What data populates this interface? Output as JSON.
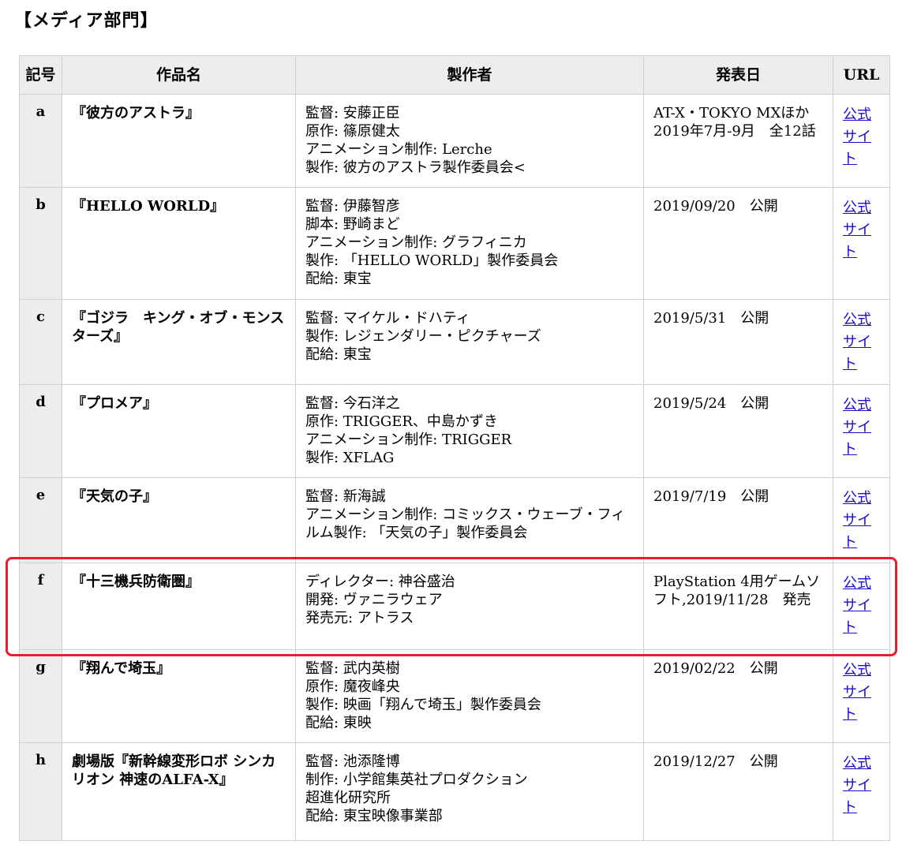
{
  "heading": "【メディア部門】",
  "columns": [
    "記号",
    "作品名",
    "製作者",
    "発表日",
    "URL"
  ],
  "rows": [
    {
      "mark": "a",
      "title": "『彼方のアストラ』",
      "maker": [
        "監督: 安藤正臣",
        "原作: 篠原健太",
        "アニメーション制作: Lerche",
        "製作: 彼方のアストラ製作委員会<"
      ],
      "date": [
        "AT-X・TOKYO MXほか",
        "2019年7月-9月　全12話"
      ],
      "url": [
        "公式",
        "サイ",
        "ト"
      ]
    },
    {
      "mark": "b",
      "title": "『HELLO WORLD』",
      "maker": [
        "監督: 伊藤智彦",
        "脚本: 野崎まど",
        "アニメーション制作: グラフィニカ",
        "製作: 「HELLO WORLD」製作委員会",
        "配給: 東宝"
      ],
      "date": [
        "2019/09/20　公開"
      ],
      "url": [
        "公式",
        "サイ",
        "ト"
      ]
    },
    {
      "mark": "c",
      "title": "『ゴジラ　キング・オブ・モンスターズ』",
      "maker": [
        "監督: マイケル・ドハティ",
        "製作: レジェンダリー・ピクチャーズ",
        "配給: 東宝"
      ],
      "date": [
        "2019/5/31　公開"
      ],
      "url": [
        "公式",
        "サイ",
        "ト"
      ]
    },
    {
      "mark": "d",
      "title": "『プロメア』",
      "maker": [
        "監督: 今石洋之",
        "原作: TRIGGER、中島かずき",
        "アニメーション制作: TRIGGER",
        "製作: XFLAG"
      ],
      "date": [
        "2019/5/24　公開"
      ],
      "url": [
        "公式",
        "サイ",
        "ト"
      ]
    },
    {
      "mark": "e",
      "title": "『天気の子』",
      "maker": [
        "監督: 新海誠",
        "アニメーション制作: コミックス・ウェーブ・フィルム製作: 「天気の子」製作委員会"
      ],
      "date": [
        "2019/7/19　公開"
      ],
      "url": [
        "公式",
        "サイ",
        "ト"
      ]
    },
    {
      "mark": "f",
      "title": "『十三機兵防衛圏』",
      "maker": [
        "ディレクター: 神谷盛治",
        "開発: ヴァニラウェア",
        "発売元: アトラス"
      ],
      "date": [
        "PlayStation 4用ゲームソフト,2019/11/28　発売"
      ],
      "url": [
        "公式",
        "サイ",
        "ト"
      ]
    },
    {
      "mark": "g",
      "title": "『翔んで埼玉』",
      "maker": [
        "監督: 武内英樹",
        "原作: 魔夜峰央",
        "製作: 映画「翔んで埼玉」製作委員会",
        "配給: 東映"
      ],
      "date": [
        "2019/02/22　公開"
      ],
      "url": [
        "公式",
        "サイ",
        "ト"
      ]
    },
    {
      "mark": "h",
      "title": "劇場版『新幹線変形ロボ シンカリオン 神速のALFA-X』",
      "maker": [
        "監督: 池添隆博",
        "制作: 小学館集英社プロダクション",
        "超進化研究所",
        "配給: 東宝映像事業部"
      ],
      "date": [
        "2019/12/27　公開"
      ],
      "url": [
        "公式",
        "サイ",
        "ト"
      ]
    }
  ],
  "colors": {
    "highlight": "#e8202e",
    "link": "#1a0dcc",
    "header_bg": "#ededed"
  }
}
